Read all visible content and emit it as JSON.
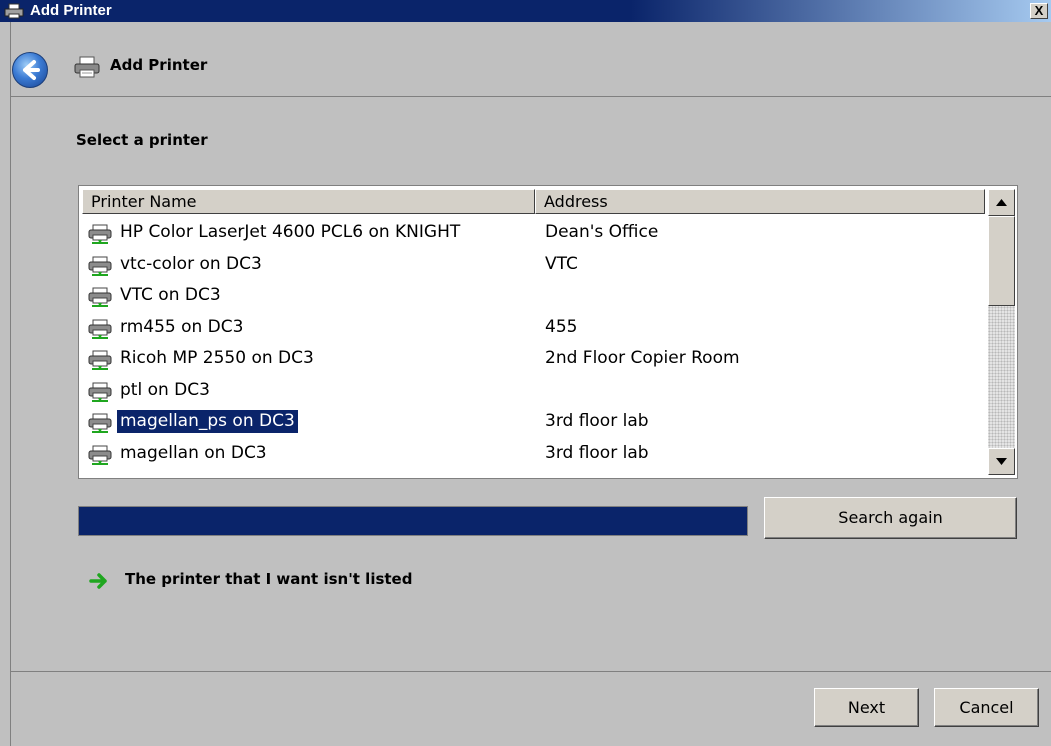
{
  "window": {
    "title": "Add Printer",
    "close_label": "X"
  },
  "header": {
    "title": "Add Printer",
    "back_icon": "back-arrow-icon"
  },
  "main": {
    "section_title": "Select a printer",
    "columns": [
      "Printer Name",
      "Address"
    ],
    "printers": [
      {
        "name": "HP Color LaserJet 4600 PCL6 on KNIGHT",
        "address": "Dean's Office",
        "selected": false
      },
      {
        "name": "vtc-color on DC3",
        "address": "VTC",
        "selected": false
      },
      {
        "name": "VTC on DC3",
        "address": "",
        "selected": false
      },
      {
        "name": "rm455 on DC3",
        "address": "455",
        "selected": false
      },
      {
        "name": "Ricoh MP 2550 on DC3",
        "address": "2nd Floor Copier Room",
        "selected": false
      },
      {
        "name": "ptl on DC3",
        "address": "",
        "selected": false
      },
      {
        "name": "magellan_ps on DC3",
        "address": "3rd floor lab",
        "selected": true
      },
      {
        "name": "magellan on DC3",
        "address": "3rd floor lab",
        "selected": false
      }
    ],
    "search_progress": 1.0,
    "search_again_label": "Search again",
    "not_listed_label": "The printer that I want isn't listed"
  },
  "footer": {
    "next_label": "Next",
    "cancel_label": "Cancel"
  },
  "colors": {
    "titlebar": "#0a246a",
    "selection": "#0a246a",
    "progress": "#0a246a",
    "dialog_bg": "#c0c0c0",
    "link_arrow": "#1fa61f"
  }
}
